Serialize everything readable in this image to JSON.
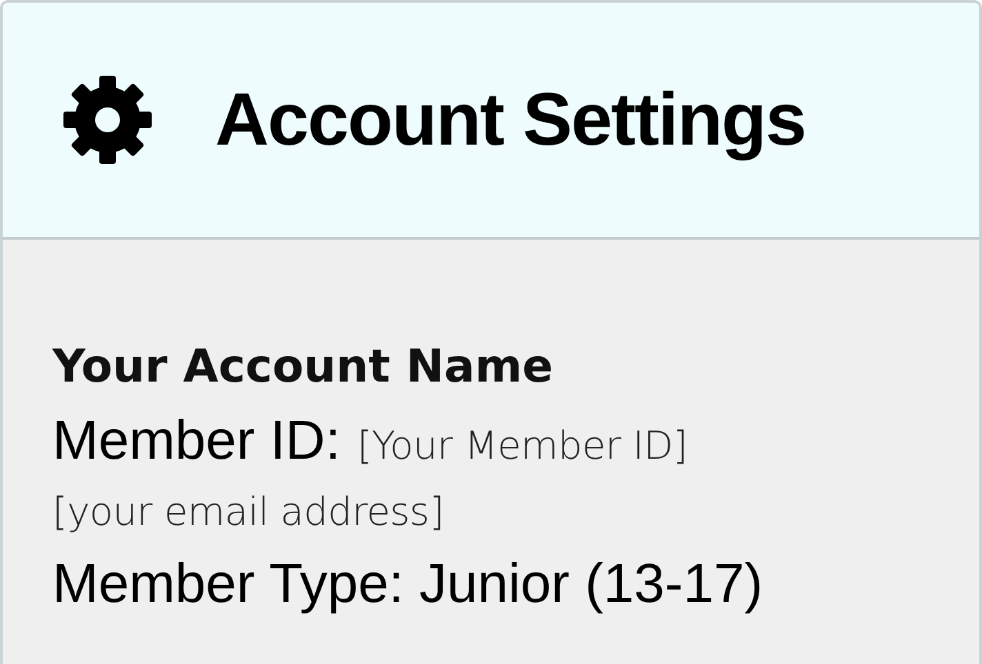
{
  "header": {
    "title": "Account Settings"
  },
  "account": {
    "name": "Your Account Name",
    "member_id_label": "Member ID:",
    "member_id": "[Your Member ID]",
    "email": "[your email address]",
    "member_type": "Member Type: Junior (13-17)"
  }
}
